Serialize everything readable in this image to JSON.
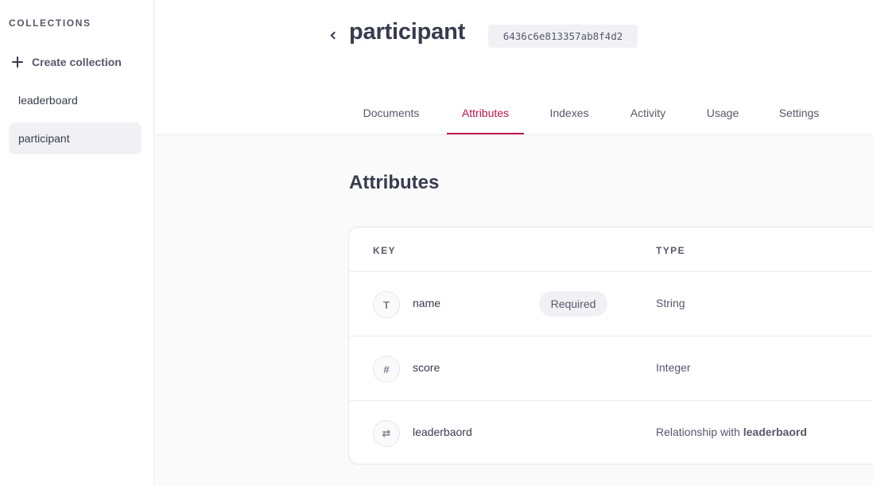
{
  "sidebar": {
    "heading": "COLLECTIONS",
    "create_label": "Create collection",
    "items": [
      {
        "label": "leaderboard"
      },
      {
        "label": "participant"
      }
    ]
  },
  "header": {
    "title": "participant",
    "id": "6436c6e813357ab8f4d2",
    "tabs": [
      {
        "label": "Documents"
      },
      {
        "label": "Attributes"
      },
      {
        "label": "Indexes"
      },
      {
        "label": "Activity"
      },
      {
        "label": "Usage"
      },
      {
        "label": "Settings"
      }
    ],
    "active_tab": "Attributes"
  },
  "main": {
    "section_title": "Attributes",
    "columns": {
      "key": "KEY",
      "type": "TYPE"
    },
    "rows": [
      {
        "icon": "text-icon",
        "glyph": "T",
        "key": "name",
        "required": "Required",
        "type": "String",
        "type_target": ""
      },
      {
        "icon": "hash-icon",
        "glyph": "#",
        "key": "score",
        "required": "",
        "type": "Integer",
        "type_target": ""
      },
      {
        "icon": "relationship-icon",
        "glyph": "⇄",
        "key": "leaderbaord",
        "required": "",
        "type": "Relationship with ",
        "type_target": "leaderbaord"
      }
    ]
  },
  "colors": {
    "accent": "#c4124d",
    "text": "#373b4d",
    "muted": "#56586a",
    "background": "#fafafb"
  }
}
